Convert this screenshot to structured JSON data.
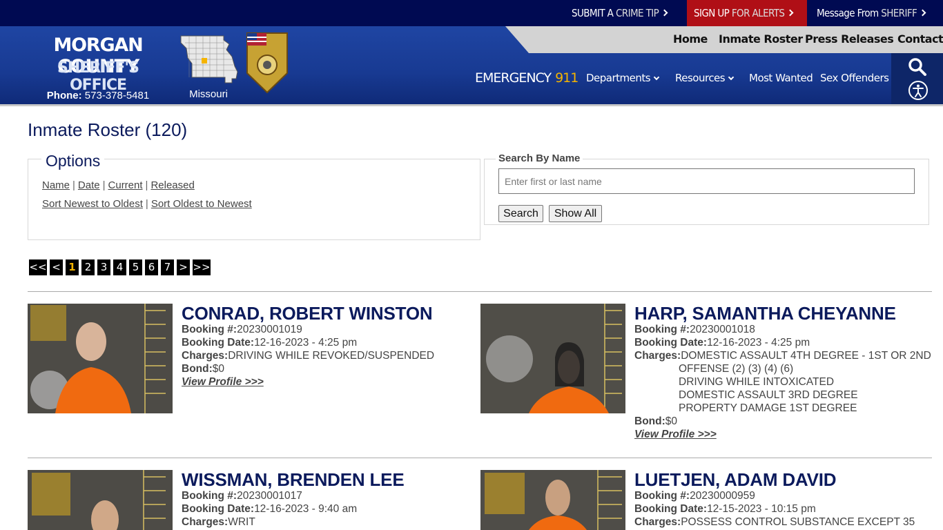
{
  "topbar": {
    "crime_tip_a": "SUBMIT A ",
    "crime_tip_b": "CRIME TIP",
    "alerts_a": "SIGN UP ",
    "alerts_b": "FOR ALERTS",
    "message_a": "Message From ",
    "message_b": "SHERIFF"
  },
  "brand": {
    "line1": "MORGAN COUNTY",
    "line2": "SHERIFF'S OFFICE",
    "phone_label": "Phone:",
    "phone_number": " 573-378-5481",
    "map_label": "Missouri"
  },
  "nav": {
    "main": [
      "Home",
      "Inmate Roster",
      "Press Releases",
      "Contact"
    ],
    "emergency_label": "EMERGENCY",
    "emergency_number": "911",
    "sub": [
      "Departments",
      "Resources",
      "Most Wanted",
      "Sex Offenders"
    ]
  },
  "page": {
    "title": "Inmate Roster (120)"
  },
  "options": {
    "legend": "Options",
    "sort_links": [
      "Name",
      "Date",
      "Current",
      "Released"
    ],
    "order_links": [
      "Sort Newest to Oldest",
      "Sort Oldest to Newest"
    ]
  },
  "search": {
    "legend": "Search By Name",
    "placeholder": "Enter first or last name",
    "search_button": "Search",
    "show_all_button": "Show All"
  },
  "pagination": {
    "first": "<<",
    "prev": "<",
    "pages": [
      "1",
      "2",
      "3",
      "4",
      "5",
      "6",
      "7"
    ],
    "current": "1",
    "next": ">",
    "last": ">>"
  },
  "labels": {
    "booking_no": "Booking #:",
    "booking_date": "Booking Date:",
    "charges": "Charges:",
    "bond": "Bond:",
    "view_profile": "View Profile >>>"
  },
  "inmates": [
    {
      "name": "CONRAD, ROBERT WINSTON",
      "booking_no": "20230001019",
      "booking_date": "12-16-2023 - 4:25 pm",
      "charges": [
        "DRIVING WHILE REVOKED/SUSPENDED"
      ],
      "bond": "$0"
    },
    {
      "name": "HARP, SAMANTHA CHEYANNE",
      "booking_no": "20230001018",
      "booking_date": "12-16-2023 - 4:25 pm",
      "charges": [
        "DOMESTIC ASSAULT 4TH DEGREE - 1ST OR 2ND",
        "OFFENSE (2) (3) (4) (6)",
        "DRIVING WHILE INTOXICATED",
        "DOMESTIC ASSAULT 3RD DEGREE",
        "PROPERTY DAMAGE 1ST DEGREE"
      ],
      "bond": "$0"
    },
    {
      "name": "WISSMAN, BRENDEN LEE",
      "booking_no": "20230001017",
      "booking_date": "12-16-2023 - 9:40 am",
      "charges": [
        "WRIT"
      ],
      "bond": ""
    },
    {
      "name": "LUETJEN, ADAM DAVID",
      "booking_no": "20230000959",
      "booking_date": "12-15-2023 - 10:15 pm",
      "charges": [
        "POSSESS CONTROL SUBSTANCE EXCEPT 35"
      ],
      "bond": ""
    }
  ],
  "colors": {
    "topbar": "#000a52",
    "header": "#1f45a3",
    "alert_red": "#b00f16",
    "accent_gold": "#f5b400",
    "title_navy": "#0b1a5c"
  }
}
